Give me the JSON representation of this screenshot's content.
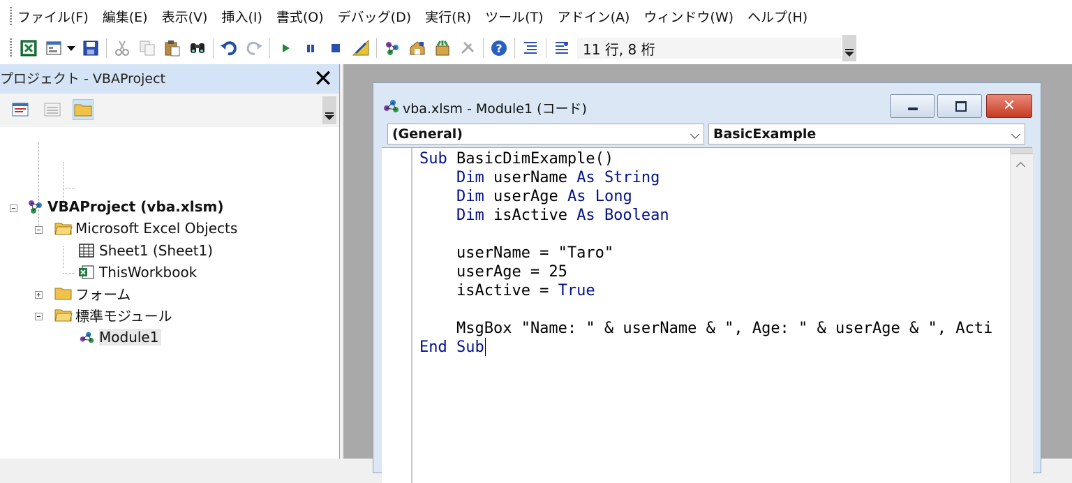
{
  "menu": [
    "ファイル(F)",
    "編集(E)",
    "表示(V)",
    "挿入(I)",
    "書式(O)",
    "デバッグ(D)",
    "実行(R)",
    "ツール(T)",
    "アドイン(A)",
    "ウィンドウ(W)",
    "ヘルプ(H)"
  ],
  "toolbar": {
    "status": "11 行, 8 桁",
    "icons": [
      "view-excel-icon",
      "insert-userform-icon",
      "dropdown-arrow-icon",
      "save-icon",
      "cut-icon",
      "copy-icon",
      "paste-icon",
      "find-icon",
      "undo-icon",
      "redo-icon",
      "run-icon",
      "break-icon",
      "reset-icon",
      "design-mode-icon",
      "project-explorer-icon",
      "properties-window-icon",
      "object-browser-icon",
      "toolbox-icon",
      "help-icon",
      "indent-icon",
      "outdent-icon"
    ]
  },
  "project_pane": {
    "title": "プロジェクト - VBAProject",
    "tree": [
      {
        "label": "VBAProject (vba.xlsm)",
        "bold": true
      },
      {
        "label": "Microsoft Excel Objects"
      },
      {
        "label": "Sheet1 (Sheet1)"
      },
      {
        "label": "ThisWorkbook"
      },
      {
        "label": "フォーム"
      },
      {
        "label": "標準モジュール"
      },
      {
        "label": "Module1"
      }
    ]
  },
  "code_window": {
    "title": "vba.xlsm - Module1 (コード)",
    "object_combo": "(General)",
    "procedure_combo": "BasicExample",
    "lines": [
      [
        {
          "t": "Sub",
          "k": 1
        },
        {
          "t": " BasicDimExample()"
        }
      ],
      [
        {
          "t": "    "
        },
        {
          "t": "Dim",
          "k": 1
        },
        {
          "t": " userName "
        },
        {
          "t": "As",
          "k": 1
        },
        {
          "t": " "
        },
        {
          "t": "String",
          "k": 1
        }
      ],
      [
        {
          "t": "    "
        },
        {
          "t": "Dim",
          "k": 1
        },
        {
          "t": " userAge "
        },
        {
          "t": "As",
          "k": 1
        },
        {
          "t": " "
        },
        {
          "t": "Long",
          "k": 1
        }
      ],
      [
        {
          "t": "    "
        },
        {
          "t": "Dim",
          "k": 1
        },
        {
          "t": " isActive "
        },
        {
          "t": "As",
          "k": 1
        },
        {
          "t": " "
        },
        {
          "t": "Boolean",
          "k": 1
        }
      ],
      [
        {
          "t": ""
        }
      ],
      [
        {
          "t": "    userName = \"Taro\""
        }
      ],
      [
        {
          "t": "    userAge = 25"
        }
      ],
      [
        {
          "t": "    isActive = "
        },
        {
          "t": "True",
          "k": 1
        }
      ],
      [
        {
          "t": ""
        }
      ],
      [
        {
          "t": "    MsgBox \"Name: \" & userName & \", Age: \" & userAge & \", Acti"
        }
      ],
      [
        {
          "t": "End Sub",
          "k": 1
        }
      ]
    ]
  },
  "colors": {
    "keyword": "#00108c",
    "title_bar": "#d4e3f5",
    "mdi_background": "#a9a9a9"
  }
}
